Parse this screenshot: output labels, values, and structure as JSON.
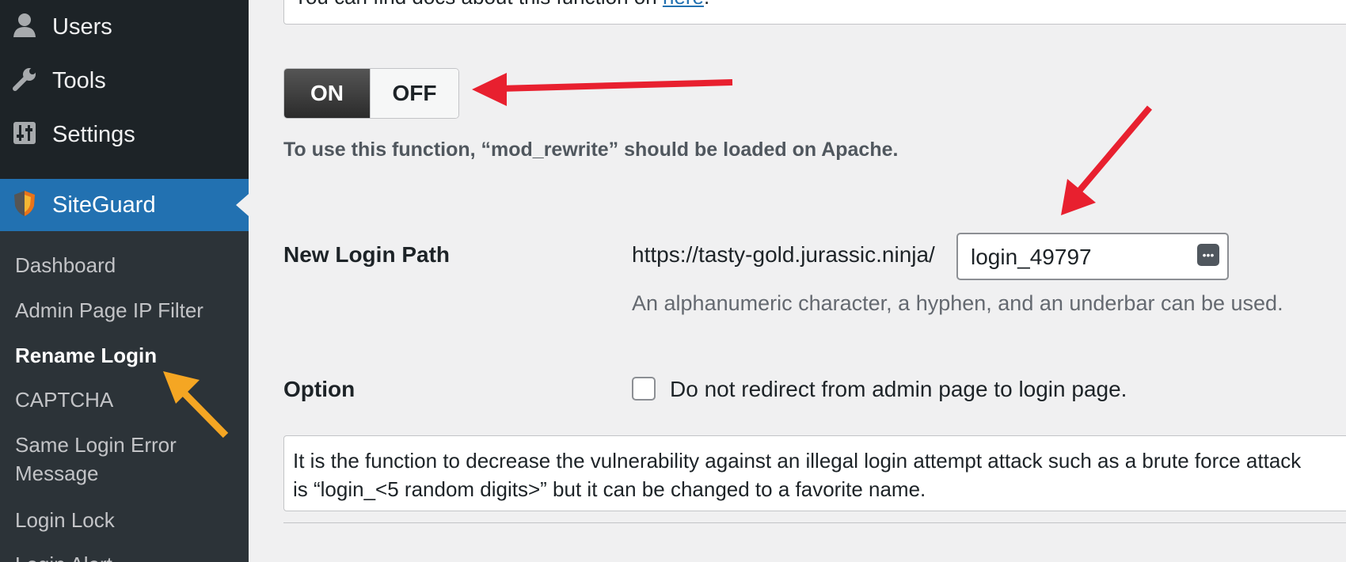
{
  "sidebar": {
    "menu": [
      {
        "label": "Users",
        "icon": "user-icon"
      },
      {
        "label": "Tools",
        "icon": "wrench-icon"
      },
      {
        "label": "Settings",
        "icon": "sliders-icon"
      },
      {
        "label": "SiteGuard",
        "icon": "shield-icon",
        "active": true
      }
    ],
    "submenu": [
      {
        "label": "Dashboard"
      },
      {
        "label": "Admin Page IP Filter"
      },
      {
        "label": "Rename Login",
        "current": true
      },
      {
        "label": "CAPTCHA"
      },
      {
        "label": "Same Login Error"
      },
      {
        "label": "Message"
      },
      {
        "label": "Login Lock"
      },
      {
        "label": "Login Alert"
      }
    ]
  },
  "main": {
    "docs_text": "You can find docs about this function on ",
    "docs_link": "here",
    "docs_end": ".",
    "toggle": {
      "on_label": "ON",
      "off_label": "OFF",
      "state": "on"
    },
    "note": "To use this function, “mod_rewrite” should be loaded on Apache.",
    "login_path": {
      "label": "New Login Path",
      "url_prefix": "https://tasty-gold.jurassic.ninja/",
      "value": "login_49797",
      "description": "An alphanumeric character, a hyphen, and an underbar can be used."
    },
    "option": {
      "label": "Option",
      "checkbox_label": "Do not redirect from admin page to login page.",
      "checked": false
    },
    "info": {
      "line1": "It is the function to decrease the vulnerability against an illegal login attempt attack such as a brute force attack",
      "line2": "is “login_<5 random digits>” but it can be changed to a favorite name."
    }
  },
  "annotations": {
    "red_arrow_color": "#e8202f",
    "orange_arrow_color": "#f5a623"
  }
}
